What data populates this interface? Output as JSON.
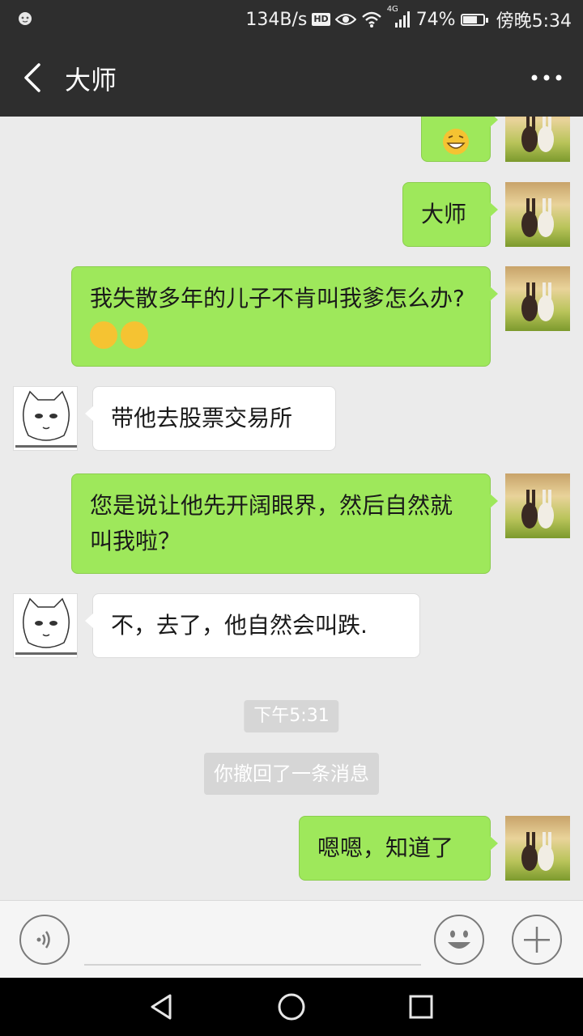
{
  "status_bar": {
    "network_speed": "134B/s",
    "hd_badge": "HD",
    "signal_label": "4G",
    "battery": "74%",
    "battery_level": 0.74,
    "time": "傍晚5:34"
  },
  "header": {
    "title": "大师"
  },
  "messages": [
    {
      "sender": "me",
      "text": "",
      "emoji": "grinning-sweat-emoji"
    },
    {
      "sender": "me",
      "text": "大师"
    },
    {
      "sender": "me",
      "text": "我失散多年的儿子不肯叫我爹怎么办?",
      "emoji": "smirk-sweat-emoji"
    },
    {
      "sender": "other",
      "text": "带他去股票交易所"
    },
    {
      "sender": "me",
      "text": "您是说让他先开阔眼界，然后自然就叫我啦？"
    },
    {
      "sender": "other",
      "text": "不，去了，他自然会叫跌."
    },
    {
      "sender": "system",
      "text": "下午5:31"
    },
    {
      "sender": "system",
      "text": "你撤回了一条消息"
    },
    {
      "sender": "me",
      "text": "嗯嗯，知道了"
    }
  ],
  "input_bar": {
    "voice_icon": "voice-icon",
    "emoji_icon": "smiley-icon",
    "plus_icon": "plus-icon"
  },
  "colors": {
    "header_bg": "#2e2e2e",
    "chat_bg": "#ebebeb",
    "my_bubble": "#9ee85b",
    "other_bubble": "#ffffff"
  }
}
